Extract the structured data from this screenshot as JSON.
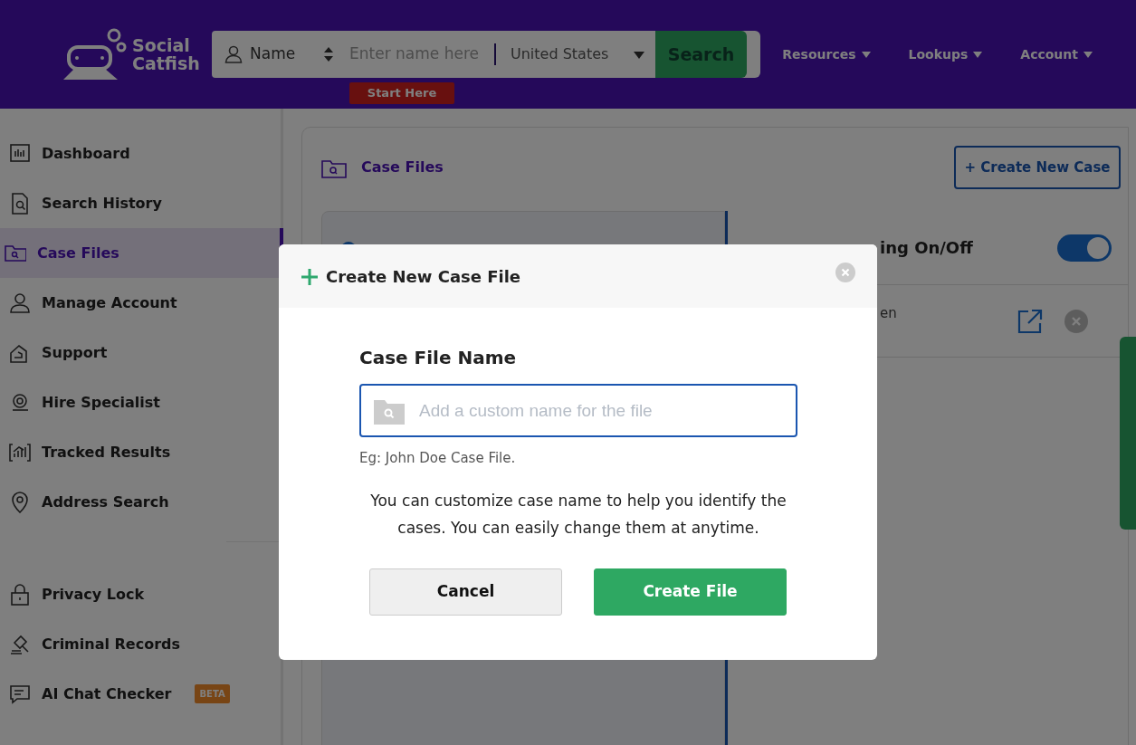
{
  "header": {
    "logo_lines": [
      "Social",
      "Catfish"
    ],
    "search": {
      "type_label": "Name",
      "placeholder": "Enter name here",
      "country": "United States",
      "button": "Search",
      "hint": "Start Here"
    },
    "nav": [
      {
        "label": "Resources"
      },
      {
        "label": "Lookups"
      },
      {
        "label": "Account"
      }
    ]
  },
  "sidebar": {
    "items": [
      {
        "label": "Dashboard",
        "selected": false
      },
      {
        "label": "Search History",
        "selected": false
      },
      {
        "label": "Case Files",
        "selected": true
      },
      {
        "label": "Manage Account",
        "selected": false
      },
      {
        "label": "Support",
        "selected": false
      },
      {
        "label": "Hire Specialist",
        "selected": false
      },
      {
        "label": "Tracked Results",
        "selected": false
      },
      {
        "label": "Address Search",
        "selected": false
      }
    ],
    "extra_items": [
      {
        "label": "Privacy Lock",
        "selected": false
      },
      {
        "label": "Criminal Records",
        "selected": false
      },
      {
        "label": "AI Chat Checker",
        "selected": false,
        "badge": "BETA"
      }
    ]
  },
  "main": {
    "title": "Case Files",
    "create_button": "+ Create New Case",
    "tracking": {
      "label": "ing On/Off",
      "on": true
    },
    "case_entry": {
      "text": "en"
    }
  },
  "modal": {
    "title": "Create New Case File",
    "field_label": "Case File Name",
    "placeholder": "Add a custom name for the file",
    "example": "Eg: John Doe Case File.",
    "description": "You can customize case name to help you identify the cases. You can easily change them at anytime.",
    "buttons": [
      {
        "label": "Cancel",
        "kind": "secondary"
      },
      {
        "label": "Create File",
        "kind": "primary"
      }
    ]
  }
}
